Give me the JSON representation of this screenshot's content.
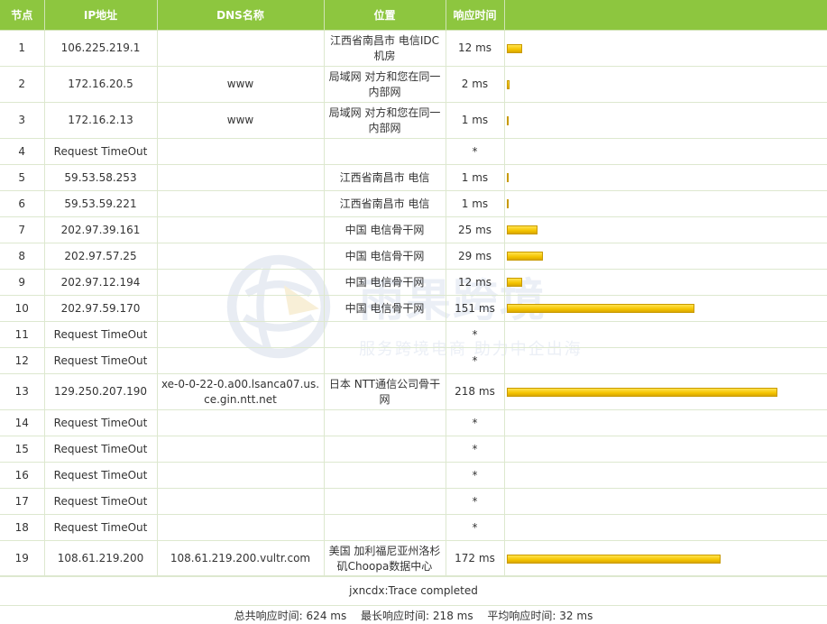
{
  "columns": {
    "node": "节点",
    "ip": "IP地址",
    "dns": "DNS名称",
    "location": "位置",
    "time": "响应时间"
  },
  "max_ms": 218,
  "hops": [
    {
      "node": "1",
      "ip": "106.225.219.1",
      "dns": "",
      "location": "江西省南昌市 电信IDC机房",
      "time": "12 ms",
      "ms": 12,
      "tall": true
    },
    {
      "node": "2",
      "ip": "172.16.20.5",
      "dns": "www",
      "location": "局域网 对方和您在同一内部网",
      "time": "2 ms",
      "ms": 2,
      "tall": true
    },
    {
      "node": "3",
      "ip": "172.16.2.13",
      "dns": "www",
      "location": "局域网 对方和您在同一内部网",
      "time": "1 ms",
      "ms": 1,
      "tall": true
    },
    {
      "node": "4",
      "ip": "Request TimeOut",
      "dns": "",
      "location": "",
      "time": "*",
      "ms": null,
      "tall": false
    },
    {
      "node": "5",
      "ip": "59.53.58.253",
      "dns": "",
      "location": "江西省南昌市 电信",
      "time": "1 ms",
      "ms": 1,
      "tall": false
    },
    {
      "node": "6",
      "ip": "59.53.59.221",
      "dns": "",
      "location": "江西省南昌市 电信",
      "time": "1 ms",
      "ms": 1,
      "tall": false
    },
    {
      "node": "7",
      "ip": "202.97.39.161",
      "dns": "",
      "location": "中国 电信骨干网",
      "time": "25 ms",
      "ms": 25,
      "tall": false
    },
    {
      "node": "8",
      "ip": "202.97.57.25",
      "dns": "",
      "location": "中国 电信骨干网",
      "time": "29 ms",
      "ms": 29,
      "tall": false
    },
    {
      "node": "9",
      "ip": "202.97.12.194",
      "dns": "",
      "location": "中国 电信骨干网",
      "time": "12 ms",
      "ms": 12,
      "tall": false
    },
    {
      "node": "10",
      "ip": "202.97.59.170",
      "dns": "",
      "location": "中国 电信骨干网",
      "time": "151 ms",
      "ms": 151,
      "tall": false
    },
    {
      "node": "11",
      "ip": "Request TimeOut",
      "dns": "",
      "location": "",
      "time": "*",
      "ms": null,
      "tall": false
    },
    {
      "node": "12",
      "ip": "Request TimeOut",
      "dns": "",
      "location": "",
      "time": "*",
      "ms": null,
      "tall": false
    },
    {
      "node": "13",
      "ip": "129.250.207.190",
      "dns": "xe-0-0-22-0.a00.lsanca07.us.ce.gin.ntt.net",
      "location": "日本 NTT通信公司骨干网",
      "time": "218 ms",
      "ms": 218,
      "tall": true
    },
    {
      "node": "14",
      "ip": "Request TimeOut",
      "dns": "",
      "location": "",
      "time": "*",
      "ms": null,
      "tall": false
    },
    {
      "node": "15",
      "ip": "Request TimeOut",
      "dns": "",
      "location": "",
      "time": "*",
      "ms": null,
      "tall": false
    },
    {
      "node": "16",
      "ip": "Request TimeOut",
      "dns": "",
      "location": "",
      "time": "*",
      "ms": null,
      "tall": false
    },
    {
      "node": "17",
      "ip": "Request TimeOut",
      "dns": "",
      "location": "",
      "time": "*",
      "ms": null,
      "tall": false
    },
    {
      "node": "18",
      "ip": "Request TimeOut",
      "dns": "",
      "location": "",
      "time": "*",
      "ms": null,
      "tall": false
    },
    {
      "node": "19",
      "ip": "108.61.219.200",
      "dns": "108.61.219.200.vultr.com",
      "location": "美国 加利福尼亚州洛杉矶Choopa数据中心",
      "time": "172 ms",
      "ms": 172,
      "tall": true
    }
  ],
  "status": "jxncdx:Trace completed",
  "summary": {
    "total_label": "总共响应时间:",
    "total_value": "624 ms",
    "longest_label": "最长响应时间:",
    "longest_value": "218 ms",
    "average_label": "平均响应时间:",
    "average_value": "32 ms"
  },
  "watermark": {
    "title": "雨果跨境",
    "slogan": "服务跨境电商 助力中企出海"
  },
  "colors": {
    "header": "#8dc63f",
    "bar": "#f4c400"
  },
  "icons": {
    "watermark_logo": "globe-logo-icon"
  }
}
